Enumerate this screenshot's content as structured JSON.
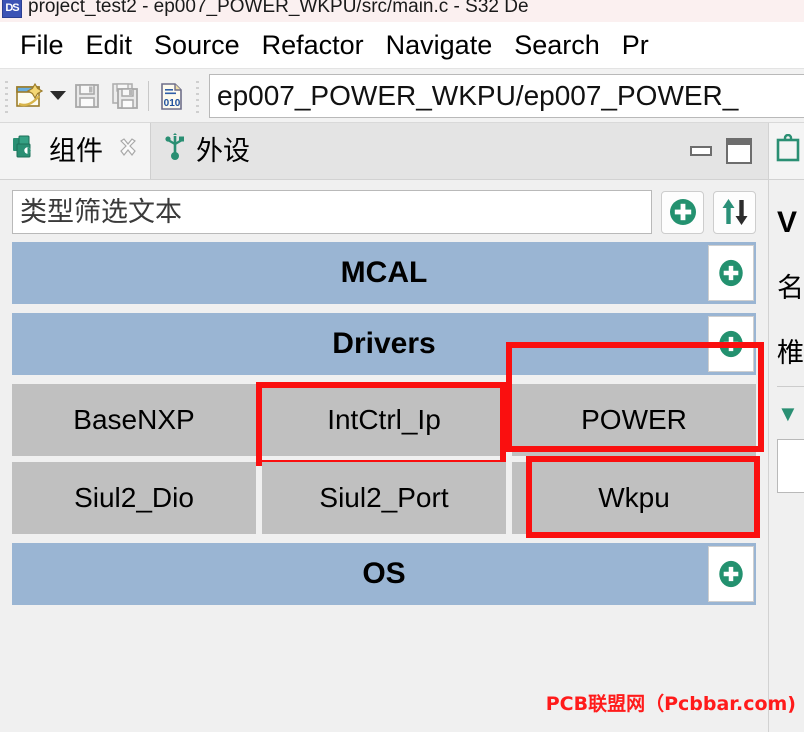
{
  "window": {
    "title": "project_test2 - ep007_POWER_WKPU/src/main.c - S32 De",
    "app_icon": "s32-design-studio-icon"
  },
  "menubar": {
    "items": [
      {
        "label": "File"
      },
      {
        "label": "Edit"
      },
      {
        "label": "Source"
      },
      {
        "label": "Refactor"
      },
      {
        "label": "Navigate"
      },
      {
        "label": "Search"
      },
      {
        "label": "Pr"
      }
    ]
  },
  "toolbar": {
    "new_icon": "new-file-icon",
    "dropdown_icon": "chevron-down-icon",
    "save_icon": "save-icon",
    "save_all_icon": "save-all-icon",
    "hex_icon": "hex-file-icon",
    "path_value": "ep007_POWER_WKPU/ep007_POWER_"
  },
  "view": {
    "tabs": [
      {
        "label": "组件",
        "icon": "components-icon",
        "active": true,
        "close_icon": "close-icon"
      },
      {
        "label": "外设",
        "icon": "usb-peripheral-icon",
        "active": false
      }
    ],
    "minimize_icon": "minimize-icon",
    "maximize_icon": "maximize-icon",
    "filter": {
      "value": "",
      "placeholder": "类型筛选文本",
      "add_icon": "add-circle-icon",
      "sort_icon": "sort-arrows-icon"
    },
    "groups": [
      {
        "title": "MCAL",
        "add_icon": "add-circle-icon",
        "items": []
      },
      {
        "title": "Drivers",
        "add_icon": "add-circle-icon",
        "items": [
          {
            "label": "BaseNXP",
            "highlighted": false
          },
          {
            "label": "IntCtrl_Ip",
            "highlighted": true
          },
          {
            "label": "POWER",
            "highlighted": true
          },
          {
            "label": "Siul2_Dio",
            "highlighted": false
          },
          {
            "label": "Siul2_Port",
            "highlighted": false
          },
          {
            "label": "Wkpu",
            "highlighted": true
          }
        ]
      },
      {
        "title": "OS",
        "add_icon": "add-circle-icon",
        "items": []
      }
    ]
  },
  "right_panel": {
    "tab_icon": "clipboard-icon",
    "title": "V",
    "line1": "名",
    "line2": "椎",
    "chevron": "▼"
  },
  "watermark": {
    "text": "PCB联盟网（Pcbbar.com)"
  },
  "colors": {
    "group_header": "#9ab5d3",
    "item_bg": "#c0c0c0",
    "highlight": "#fa0f0f",
    "accent_green": "#2a8f73",
    "watermark_red": "#ff1b1b"
  }
}
